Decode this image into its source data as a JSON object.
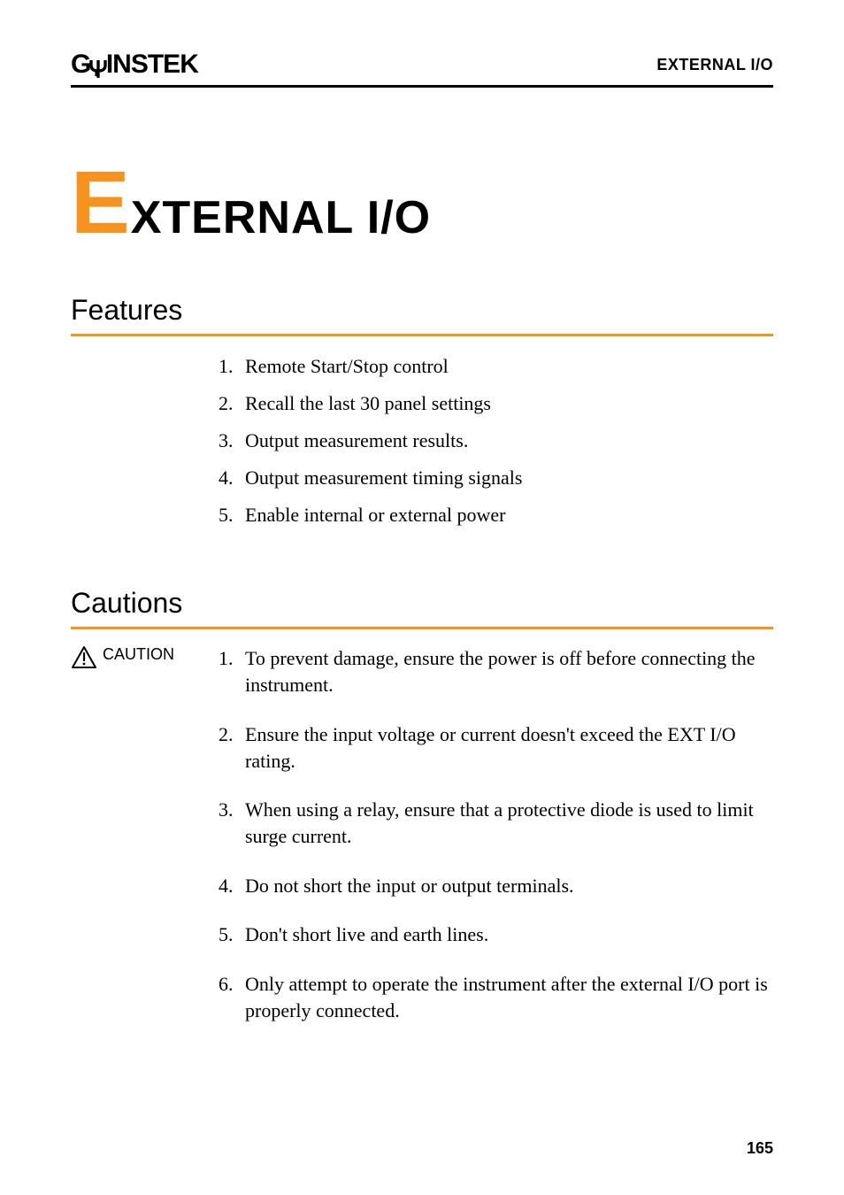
{
  "header": {
    "logo_g": "G",
    "logo_rest": "INSTEK",
    "section": "EXTERNAL I/O"
  },
  "chapter": {
    "first_letter": "E",
    "rest": "XTERNAL I/O"
  },
  "features": {
    "title": "Features",
    "items": [
      "Remote Start/Stop control",
      "Recall the last 30 panel settings",
      "Output measurement results.",
      "Output measurement timing signals",
      "Enable internal or external power"
    ]
  },
  "cautions": {
    "title": "Cautions",
    "label": "CAUTION",
    "items": [
      "To prevent damage, ensure the power is off before connecting the instrument.",
      "Ensure the input voltage or current doesn't exceed the EXT I/O rating.",
      "When using a relay, ensure that a protective diode is used to limit surge current.",
      "Do not short the input or output terminals.",
      "Don't short live and earth lines.",
      "Only attempt to operate the instrument after the external I/O port is properly connected."
    ]
  },
  "page_number": "165"
}
